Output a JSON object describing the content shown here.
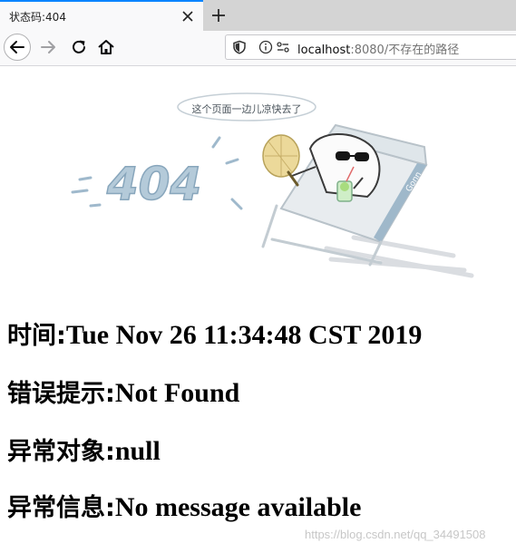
{
  "browser": {
    "tab": {
      "title": "状态码:404"
    },
    "url": {
      "host": "localhost",
      "rest": ":8080/不存在的路径"
    }
  },
  "illustration": {
    "text_404": "404",
    "caption": "这个页面一边儿凉快去了",
    "chair_brand": "Gonn"
  },
  "info": {
    "time": {
      "label": "时间:",
      "value": "Tue Nov 26 11:34:48 CST 2019"
    },
    "error": {
      "label": "错误提示:",
      "value": "Not Found"
    },
    "exception": {
      "label": "异常对象:",
      "value": "null"
    },
    "message": {
      "label": "异常信息:",
      "value": "No message available"
    }
  },
  "watermark": "https://blog.csdn.net/qq_34491508"
}
